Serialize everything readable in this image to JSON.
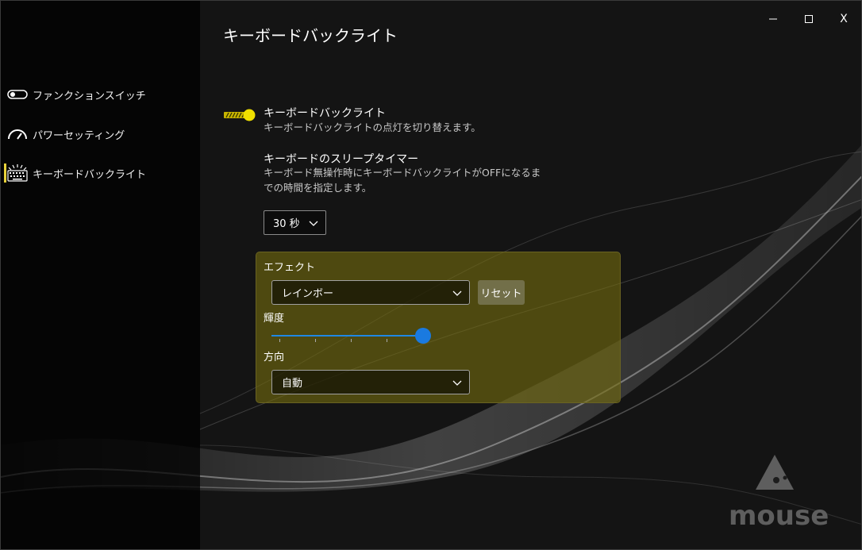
{
  "window": {
    "minimize_label": "—",
    "maximize_label": "☐",
    "close_label": "X"
  },
  "sidebar": {
    "items": [
      {
        "label": "ファンクションスイッチ",
        "icon": "toggle-icon"
      },
      {
        "label": "パワーセッティング",
        "icon": "gauge-icon"
      },
      {
        "label": "キーボードバックライト",
        "icon": "keyboard-backlight-icon",
        "active": true
      }
    ]
  },
  "page": {
    "title": "キーボードバックライト"
  },
  "backlight": {
    "title": "キーボードバックライト",
    "description": "キーボードバックライトの点灯を切り替えます。",
    "enabled": true
  },
  "sleep_timer": {
    "title": "キーボードのスリープタイマー",
    "description": "キーボード無操作時にキーボードバックライトがOFFになるまでの時間を指定します。",
    "value": "30 秒"
  },
  "effect": {
    "label": "エフェクト",
    "value": "レインボー",
    "reset_label": "リセット",
    "brightness_label": "輝度",
    "brightness_level": 1.0,
    "direction_label": "方向",
    "direction_value": "自動"
  },
  "brand": {
    "logo_text": "mouse"
  },
  "colors": {
    "accent": "#e8d23a",
    "toggle_on": "#f0e000",
    "slider": "#1a7ae0",
    "panel": "#746c0e"
  }
}
